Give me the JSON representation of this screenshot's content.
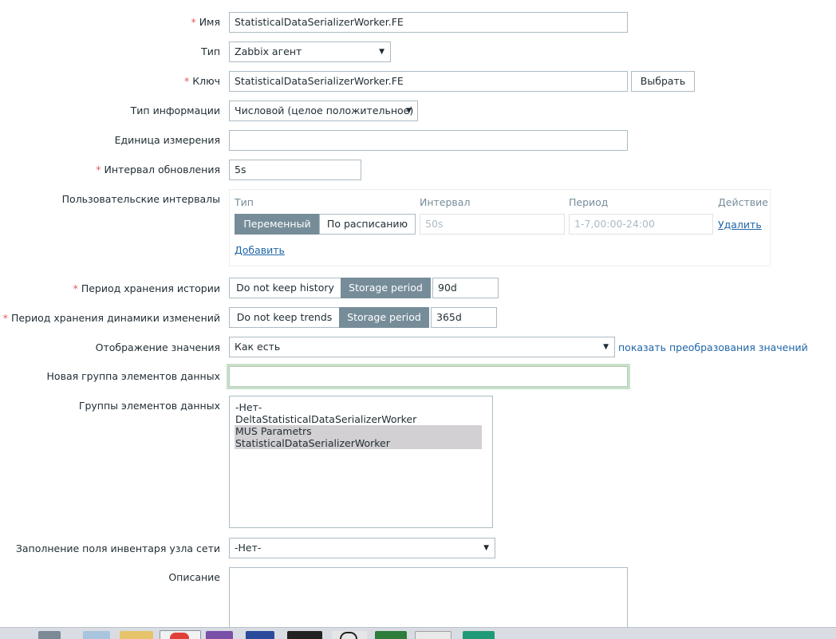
{
  "form": {
    "name": {
      "label": "Имя",
      "value": "StatisticalDataSerializerWorker.FE"
    },
    "type": {
      "label": "Тип",
      "value": "Zabbix агент"
    },
    "key": {
      "label": "Ключ",
      "value": "StatisticalDataSerializerWorker.FE",
      "button": "Выбрать"
    },
    "info_type": {
      "label": "Тип информации",
      "value": "Числовой (целое положительное)"
    },
    "units": {
      "label": "Единица измерения",
      "value": ""
    },
    "update_interval": {
      "label": "Интервал обновления",
      "value": "5s"
    },
    "custom_intervals": {
      "label": "Пользовательские интервалы",
      "headers": {
        "type": "Тип",
        "interval": "Интервал",
        "period": "Период",
        "action": "Действие"
      },
      "row": {
        "type_options": [
          "Переменный",
          "По расписанию"
        ],
        "selected": "Переменный",
        "interval_placeholder": "50s",
        "period_placeholder": "1-7,00:00-24:00",
        "remove": "Удалить"
      },
      "add": "Добавить"
    },
    "history": {
      "label": "Период хранения истории",
      "options": [
        "Do not keep history",
        "Storage period"
      ],
      "selected": "Storage period",
      "value": "90d"
    },
    "trends": {
      "label": "Период хранения динамики изменений",
      "options": [
        "Do not keep trends",
        "Storage period"
      ],
      "selected": "Storage period",
      "value": "365d"
    },
    "value_map": {
      "label": "Отображение значения",
      "value": "Как есть",
      "link": "показать преобразования значений"
    },
    "new_app": {
      "label": "Новая группа элементов данных",
      "value": ""
    },
    "apps": {
      "label": "Группы элементов данных",
      "items": [
        {
          "text": "-Нет-",
          "selected": false
        },
        {
          "text": "DeltaStatisticalDataSerializerWorker",
          "selected": false
        },
        {
          "text": "MUS Parametrs",
          "selected": true
        },
        {
          "text": "StatisticalDataSerializerWorker",
          "selected": true
        }
      ]
    },
    "inventory": {
      "label": "Заполнение поля инвентаря узла сети",
      "value": "-Нет-"
    },
    "description": {
      "label": "Описание",
      "value": ""
    }
  },
  "colors": {
    "required": "#e45959",
    "link": "#1f65a6",
    "segment_active": "#768d99",
    "focus_glow": "#c8e0c9"
  }
}
